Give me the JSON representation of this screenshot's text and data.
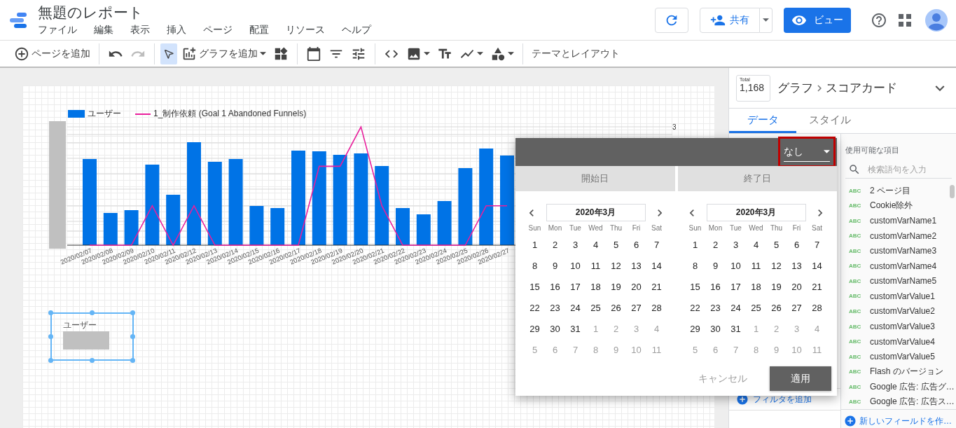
{
  "app": {
    "title": "無題のレポート",
    "menu": [
      "ファイル",
      "編集",
      "表示",
      "挿入",
      "ページ",
      "配置",
      "リソース",
      "ヘルプ"
    ]
  },
  "header_actions": {
    "share": "共有",
    "view": "ビュー"
  },
  "toolbar": {
    "groups": [
      [
        {
          "kind": "addpage",
          "label": "ページを追加",
          "selected": false,
          "dropdown": false
        }
      ],
      [
        {
          "kind": "undo",
          "selected": false,
          "disabled": false,
          "dropdown": false
        },
        {
          "kind": "redo",
          "selected": false,
          "disabled": true,
          "dropdown": false
        }
      ],
      [
        {
          "kind": "select",
          "selected": true,
          "dropdown": false
        },
        {
          "kind": "addchart",
          "label": "グラフを追加",
          "selected": false,
          "dropdown": true
        },
        {
          "kind": "components",
          "selected": false,
          "dropdown": false
        }
      ],
      [
        {
          "kind": "date",
          "selected": false,
          "dropdown": false
        },
        {
          "kind": "filter",
          "selected": false,
          "dropdown": false
        },
        {
          "kind": "datacontrol",
          "selected": false,
          "dropdown": false
        }
      ],
      [
        {
          "kind": "code",
          "selected": false,
          "dropdown": false
        },
        {
          "kind": "image",
          "selected": false,
          "dropdown": true
        },
        {
          "kind": "text",
          "selected": false,
          "dropdown": false
        },
        {
          "kind": "line",
          "selected": false,
          "dropdown": true
        },
        {
          "kind": "shape",
          "selected": false,
          "dropdown": true
        }
      ],
      [
        {
          "kind": "theme",
          "label": "テーマとレイアウト",
          "selected": false,
          "dropdown": false
        }
      ]
    ]
  },
  "chart": {
    "legend": [
      {
        "kind": "bar",
        "label": "ユーザー",
        "color": "#0073e6"
      },
      {
        "kind": "line",
        "label": "1_制作依頼 (Goal 1 Abandoned Funnels)",
        "color": "#e91e9c"
      }
    ],
    "axis_tick": "3",
    "dates": [
      "2020/02/07",
      "2020/02/08",
      "2020/02/09",
      "2020/02/10",
      "2020/02/11",
      "2020/02/12",
      "2020/02/13",
      "2020/02/14",
      "2020/02/15",
      "2020/02/16",
      "2020/02/17",
      "2020/02/18",
      "2020/02/19",
      "2020/02/20",
      "2020/02/21",
      "2020/02/22",
      "2020/02/23",
      "2020/02/24",
      "2020/02/25",
      "2020/02/26",
      "2020/02/27"
    ]
  },
  "scorecard": {
    "label": "ユーザー",
    "selected": true
  },
  "panel": {
    "total_label": "Total",
    "total_value": "1,168",
    "breadcrumb": [
      "グラフ",
      "スコアカード"
    ],
    "tabs": [
      {
        "label": "データ",
        "selected": true
      },
      {
        "label": "スタイル",
        "selected": false
      }
    ],
    "add_filter": "フィルタを追加",
    "fields_title": "使用可能な項目",
    "search_placeholder": "検索語句を入力",
    "fields": [
      {
        "type": "ABC",
        "name": "2 ページ目"
      },
      {
        "type": "ABC",
        "name": "Cookie除外"
      },
      {
        "type": "ABC",
        "name": "customVarName1"
      },
      {
        "type": "ABC",
        "name": "customVarName2"
      },
      {
        "type": "ABC",
        "name": "customVarName3"
      },
      {
        "type": "ABC",
        "name": "customVarName4"
      },
      {
        "type": "ABC",
        "name": "customVarName5"
      },
      {
        "type": "ABC",
        "name": "customVarValue1"
      },
      {
        "type": "ABC",
        "name": "customVarValue2"
      },
      {
        "type": "ABC",
        "name": "customVarValue3"
      },
      {
        "type": "ABC",
        "name": "customVarValue4"
      },
      {
        "type": "ABC",
        "name": "customVarValue5"
      },
      {
        "type": "ABC",
        "name": "Flash のバージョン"
      },
      {
        "type": "ABC",
        "name": "Google 広告: 広告グ…"
      },
      {
        "type": "ABC",
        "name": "Google 広告: 広告ス…"
      }
    ],
    "new_field": "新しいフィールドを作…"
  },
  "popup": {
    "preset": "なし",
    "tabs": [
      "開始日",
      "終了日"
    ],
    "cancel": "キャンセル",
    "apply": "適用",
    "calendars": [
      {
        "month": "2020年3月",
        "weekdays": [
          "Sun",
          "Mon",
          "Tue",
          "Wed",
          "Thu",
          "Fri",
          "Sat"
        ],
        "days": [
          {
            "d": "1",
            "outside": false
          },
          {
            "d": "2",
            "outside": false
          },
          {
            "d": "3",
            "outside": false
          },
          {
            "d": "4",
            "outside": false
          },
          {
            "d": "5",
            "outside": false
          },
          {
            "d": "6",
            "outside": false
          },
          {
            "d": "7",
            "outside": false
          },
          {
            "d": "8",
            "outside": false
          },
          {
            "d": "9",
            "outside": false
          },
          {
            "d": "10",
            "outside": false
          },
          {
            "d": "11",
            "outside": false
          },
          {
            "d": "12",
            "outside": false
          },
          {
            "d": "13",
            "outside": false
          },
          {
            "d": "14",
            "outside": false
          },
          {
            "d": "15",
            "outside": false
          },
          {
            "d": "16",
            "outside": false
          },
          {
            "d": "17",
            "outside": false
          },
          {
            "d": "18",
            "outside": false
          },
          {
            "d": "19",
            "outside": false
          },
          {
            "d": "20",
            "outside": false
          },
          {
            "d": "21",
            "outside": false
          },
          {
            "d": "22",
            "outside": false
          },
          {
            "d": "23",
            "outside": false
          },
          {
            "d": "24",
            "outside": false
          },
          {
            "d": "25",
            "outside": false
          },
          {
            "d": "26",
            "outside": false
          },
          {
            "d": "27",
            "outside": false
          },
          {
            "d": "28",
            "outside": false
          },
          {
            "d": "29",
            "outside": false
          },
          {
            "d": "30",
            "outside": false
          },
          {
            "d": "31",
            "outside": false
          },
          {
            "d": "1",
            "outside": true
          },
          {
            "d": "2",
            "outside": true
          },
          {
            "d": "3",
            "outside": true
          },
          {
            "d": "4",
            "outside": true
          },
          {
            "d": "5",
            "outside": true
          },
          {
            "d": "6",
            "outside": true
          },
          {
            "d": "7",
            "outside": true
          },
          {
            "d": "8",
            "outside": true
          },
          {
            "d": "9",
            "outside": true
          },
          {
            "d": "10",
            "outside": true
          },
          {
            "d": "11",
            "outside": true
          }
        ]
      },
      {
        "month": "2020年3月",
        "weekdays": [
          "Sun",
          "Mon",
          "Tue",
          "Wed",
          "Thu",
          "Fri",
          "Sat"
        ],
        "days": [
          {
            "d": "1",
            "outside": false
          },
          {
            "d": "2",
            "outside": false
          },
          {
            "d": "3",
            "outside": false
          },
          {
            "d": "4",
            "outside": false
          },
          {
            "d": "5",
            "outside": false
          },
          {
            "d": "6",
            "outside": false
          },
          {
            "d": "7",
            "outside": false
          },
          {
            "d": "8",
            "outside": false
          },
          {
            "d": "9",
            "outside": false
          },
          {
            "d": "10",
            "outside": false
          },
          {
            "d": "11",
            "outside": false
          },
          {
            "d": "12",
            "outside": false
          },
          {
            "d": "13",
            "outside": false
          },
          {
            "d": "14",
            "outside": false
          },
          {
            "d": "15",
            "outside": false
          },
          {
            "d": "16",
            "outside": false
          },
          {
            "d": "17",
            "outside": false
          },
          {
            "d": "18",
            "outside": false
          },
          {
            "d": "19",
            "outside": false
          },
          {
            "d": "20",
            "outside": false
          },
          {
            "d": "21",
            "outside": false
          },
          {
            "d": "22",
            "outside": false
          },
          {
            "d": "23",
            "outside": false
          },
          {
            "d": "24",
            "outside": false
          },
          {
            "d": "25",
            "outside": false
          },
          {
            "d": "26",
            "outside": false
          },
          {
            "d": "27",
            "outside": false
          },
          {
            "d": "28",
            "outside": false
          },
          {
            "d": "29",
            "outside": false
          },
          {
            "d": "30",
            "outside": false
          },
          {
            "d": "31",
            "outside": false
          },
          {
            "d": "1",
            "outside": true
          },
          {
            "d": "2",
            "outside": true
          },
          {
            "d": "3",
            "outside": true
          },
          {
            "d": "4",
            "outside": true
          },
          {
            "d": "5",
            "outside": true
          },
          {
            "d": "6",
            "outside": true
          },
          {
            "d": "7",
            "outside": true
          },
          {
            "d": "8",
            "outside": true
          },
          {
            "d": "9",
            "outside": true
          },
          {
            "d": "10",
            "outside": true
          },
          {
            "d": "11",
            "outside": true
          }
        ]
      }
    ]
  }
}
